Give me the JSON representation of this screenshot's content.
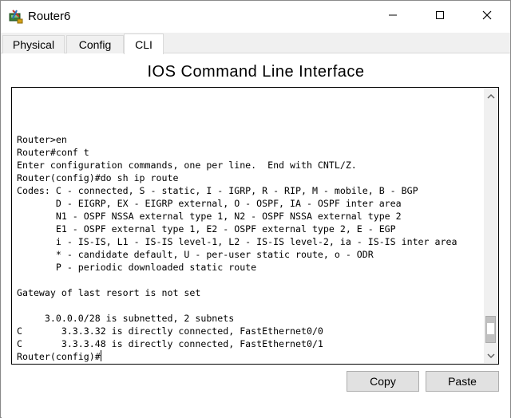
{
  "window": {
    "title": "Router6",
    "icon": "router-icon",
    "controls": [
      "minimize-icon",
      "maximize-icon",
      "close-icon"
    ]
  },
  "tabs": [
    {
      "label": "Physical",
      "active": false
    },
    {
      "label": "Config",
      "active": false
    },
    {
      "label": "CLI",
      "active": true
    }
  ],
  "cli": {
    "heading": "IOS Command Line Interface",
    "lines": [
      "Router>en",
      "Router#conf t",
      "Enter configuration commands, one per line.  End with CNTL/Z.",
      "Router(config)#do sh ip route",
      "Codes: C - connected, S - static, I - IGRP, R - RIP, M - mobile, B - BGP",
      "       D - EIGRP, EX - EIGRP external, O - OSPF, IA - OSPF inter area",
      "       N1 - OSPF NSSA external type 1, N2 - OSPF NSSA external type 2",
      "       E1 - OSPF external type 1, E2 - OSPF external type 2, E - EGP",
      "       i - IS-IS, L1 - IS-IS level-1, L2 - IS-IS level-2, ia - IS-IS inter area",
      "       * - candidate default, U - per-user static route, o - ODR",
      "       P - periodic downloaded static route",
      "",
      "Gateway of last resort is not set",
      "",
      "     3.0.0.0/28 is subnetted, 2 subnets",
      "C       3.3.3.32 is directly connected, FastEthernet0/0",
      "C       3.3.3.48 is directly connected, FastEthernet0/1"
    ],
    "prompt": "Router(config)#"
  },
  "buttons": {
    "copy": "Copy",
    "paste": "Paste"
  }
}
